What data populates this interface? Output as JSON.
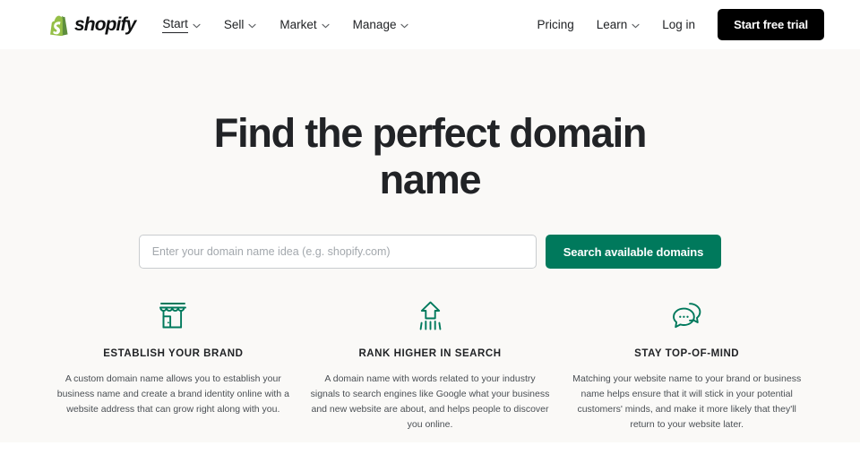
{
  "brand": {
    "name": "shopify",
    "logo_icon": "shopify-bag-icon",
    "logo_green_light": "#95BF47",
    "logo_green_dark": "#5E8E3E"
  },
  "colors": {
    "accent_green": "#00795c",
    "cta_black": "#000000",
    "hero_background": "#faf9f7",
    "text_primary": "#212326",
    "text_body": "#4a4f54",
    "placeholder": "#a3a8ad",
    "input_border": "#c9cccf"
  },
  "header": {
    "nav_left": [
      {
        "label": "Start",
        "has_chevron": true,
        "active": true
      },
      {
        "label": "Sell",
        "has_chevron": true,
        "active": false
      },
      {
        "label": "Market",
        "has_chevron": true,
        "active": false
      },
      {
        "label": "Manage",
        "has_chevron": true,
        "active": false
      }
    ],
    "nav_right": [
      {
        "label": "Pricing",
        "has_chevron": false
      },
      {
        "label": "Learn",
        "has_chevron": true
      },
      {
        "label": "Log in",
        "has_chevron": false
      }
    ],
    "cta_label": "Start free trial"
  },
  "hero": {
    "title": "Find the perfect domain name",
    "search": {
      "placeholder": "Enter your domain name idea (e.g. shopify.com)",
      "value": "",
      "button_label": "Search available domains"
    }
  },
  "features": [
    {
      "icon": "storefront-icon",
      "title": "ESTABLISH YOUR BRAND",
      "body": "A custom domain name allows you to establish your business name and create a brand identity online with a website address that can grow right along with you."
    },
    {
      "icon": "upward-arrow-icon",
      "title": "RANK HIGHER IN SEARCH",
      "body": "A domain name with words related to your industry signals to search engines like Google what your business and new website are about, and helps people to discover you online."
    },
    {
      "icon": "chat-bubbles-icon",
      "title": "STAY TOP-OF-MIND",
      "body": "Matching your website name to your brand or business name helps ensure that it will stick in your potential customers' minds, and make it more likely that they'll return to your website later."
    }
  ]
}
